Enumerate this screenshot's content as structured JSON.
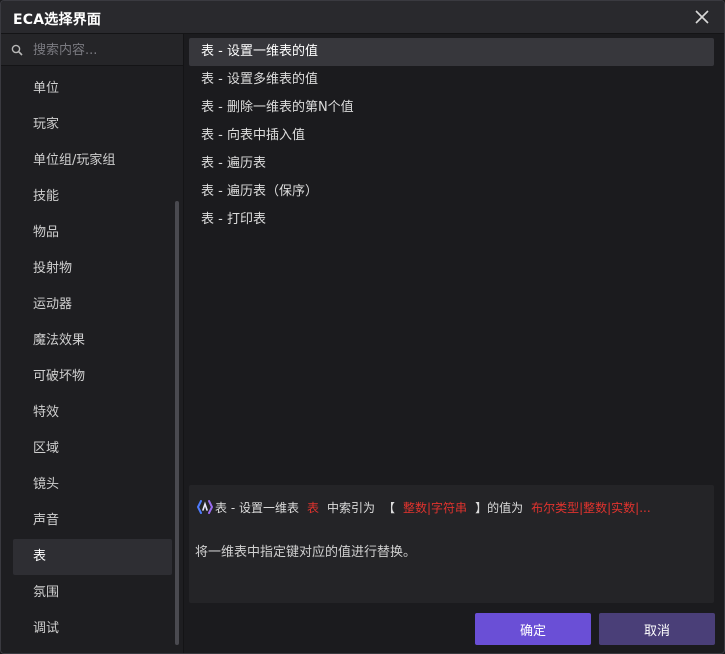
{
  "window": {
    "title": "ECA选择界面"
  },
  "search": {
    "placeholder": "搜索内容..."
  },
  "categories": [
    {
      "label": "单位"
    },
    {
      "label": "玩家"
    },
    {
      "label": "单位组/玩家组"
    },
    {
      "label": "技能"
    },
    {
      "label": "物品"
    },
    {
      "label": "投射物"
    },
    {
      "label": "运动器"
    },
    {
      "label": "魔法效果"
    },
    {
      "label": "可破坏物"
    },
    {
      "label": "特效"
    },
    {
      "label": "区域"
    },
    {
      "label": "镜头"
    },
    {
      "label": "声音"
    },
    {
      "label": "表"
    },
    {
      "label": "氛围"
    },
    {
      "label": "调试"
    }
  ],
  "selected_category": "表",
  "functions": [
    {
      "label": "表 - 设置一维表的值"
    },
    {
      "label": "表 - 设置多维表的值"
    },
    {
      "label": "表 - 删除一维表的第N个值"
    },
    {
      "label": "表 - 向表中插入值"
    },
    {
      "label": "表 - 遍历表"
    },
    {
      "label": "表 - 遍历表（保序）"
    },
    {
      "label": "表 - 打印表"
    }
  ],
  "selected_function": "表 - 设置一维表的值",
  "description": {
    "part1": "表 - 设置一维表",
    "param1": "表",
    "part2": "中索引为",
    "bracket_open": "【",
    "param2": "整数|字符串",
    "bracket_close": "】的值为",
    "param3": "布尔类型|整数|实数|...",
    "text": "将一维表中指定键对应的值进行替换。"
  },
  "buttons": {
    "confirm": "确定",
    "cancel": "取消"
  },
  "colors": {
    "accent": "#6a4fd6",
    "cancel": "#4a3f78",
    "param_red": "#e0332e",
    "logo_blue": "#4f7cff"
  },
  "icons": {
    "close": "close-icon",
    "search": "search-icon",
    "logo": "eca-logo-icon"
  }
}
